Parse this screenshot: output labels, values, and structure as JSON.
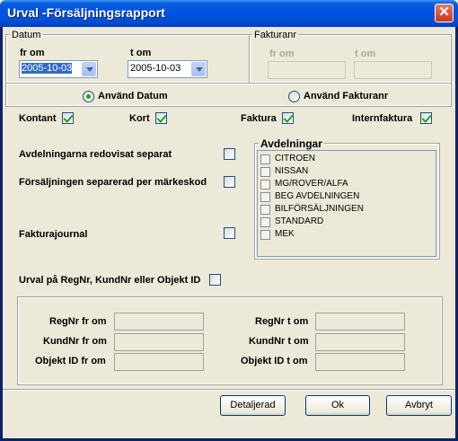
{
  "window": {
    "title": "Urval -Försäljningsrapport",
    "close_glyph": "✕"
  },
  "datum": {
    "legend": "Datum",
    "from_label": "fr om",
    "to_label": "t om",
    "from_value": "2005-10-03",
    "to_value": "2005-10-03"
  },
  "fakturanr": {
    "legend": "Fakturanr",
    "from_label": "fr om",
    "to_label": "t om",
    "from_value": "",
    "to_value": ""
  },
  "mode": {
    "use_datum": "Använd Datum",
    "use_fakturanr": "Använd Fakturanr",
    "selected": "datum"
  },
  "payment_types": [
    {
      "label": "Kontant",
      "checked": true
    },
    {
      "label": "Kort",
      "checked": true
    },
    {
      "label": "Faktura",
      "checked": true
    },
    {
      "label": "Internfaktura",
      "checked": true
    }
  ],
  "options": {
    "avdelningar_separat": {
      "label": "Avdelningarna redovisat separat",
      "checked": false
    },
    "markeskod": {
      "label": "Försäljningen separerad per märkeskod",
      "checked": false
    },
    "fakturajournal": {
      "label": "Fakturajournal",
      "checked": false
    },
    "urval_regnr": {
      "label": "Urval på RegNr, KundNr eller Objekt ID",
      "checked": false
    }
  },
  "avdelningar": {
    "legend": "Avdelningar",
    "items": [
      "CITROEN",
      "NISSAN",
      "MG/ROVER/ALFA",
      "BEG AVDELNINGEN",
      "BILFÖRSÄLJNINGEN",
      "STANDARD",
      "MEK"
    ]
  },
  "filters": {
    "regnr_from": "RegNr fr om",
    "regnr_to": "RegNr t om",
    "kundnr_from": "KundNr fr om",
    "kundnr_to": "KundNr t om",
    "objekt_from": "Objekt ID fr om",
    "objekt_to": "Objekt ID t om"
  },
  "buttons": {
    "detaljerad": "Detaljerad",
    "ok": "Ok",
    "avbryt": "Avbryt"
  }
}
